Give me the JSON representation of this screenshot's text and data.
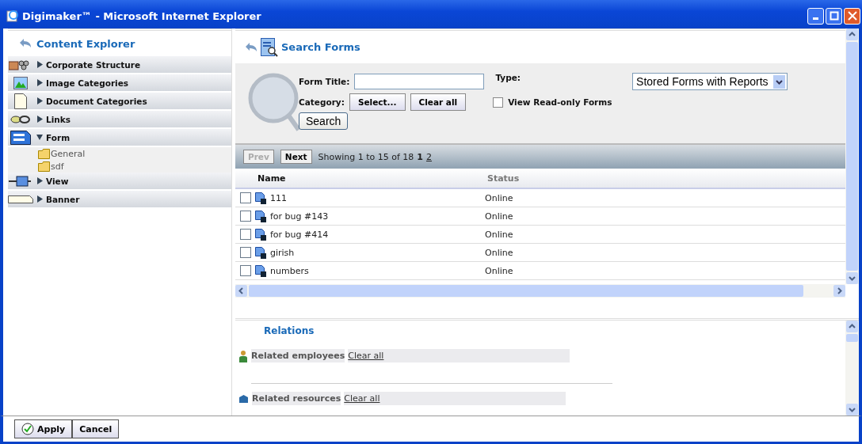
{
  "window": {
    "title": "Digimaker™ - Microsoft Internet Explorer"
  },
  "sidebar": {
    "title": "Content Explorer",
    "items": [
      {
        "label": "Corporate Structure",
        "expanded": false
      },
      {
        "label": "Image Categories",
        "expanded": false
      },
      {
        "label": "Document Categories",
        "expanded": false
      },
      {
        "label": "Links",
        "expanded": false
      },
      {
        "label": "Form",
        "expanded": true,
        "children": [
          {
            "label": "General"
          },
          {
            "label": "sdf"
          }
        ]
      },
      {
        "label": "View",
        "expanded": false
      },
      {
        "label": "Banner",
        "expanded": false
      }
    ]
  },
  "search_panel": {
    "title": "Search Forms",
    "form_title_label": "Form Title:",
    "category_label": "Category:",
    "select_button": "Select...",
    "clear_button": "Clear all",
    "type_label": "Type:",
    "type_value": "Stored Forms with Reports",
    "readonly_label": "View Read-only Forms",
    "readonly_checked": false,
    "search_button": "Search"
  },
  "pager": {
    "prev": "Prev",
    "prev_disabled": true,
    "next": "Next",
    "summary": "Showing 1 to 15 of 18",
    "pages": [
      {
        "label": "1",
        "selected": true
      },
      {
        "label": "2",
        "selected": false
      }
    ]
  },
  "table": {
    "columns": [
      "Name",
      "Status"
    ],
    "rows": [
      {
        "name": "111",
        "status": "Online",
        "checked": false
      },
      {
        "name": "for bug #143",
        "status": "Online",
        "checked": false
      },
      {
        "name": "for bug #414",
        "status": "Online",
        "checked": false
      },
      {
        "name": "girish",
        "status": "Online",
        "checked": false
      },
      {
        "name": "numbers",
        "status": "Online",
        "checked": false
      }
    ]
  },
  "relations": {
    "title": "Relations",
    "groups": [
      {
        "label": "Related employees",
        "clear": "Clear all",
        "kind": "employees"
      },
      {
        "label": "Related resources",
        "clear": "Clear all",
        "kind": "resources"
      }
    ]
  },
  "buttons": [
    {
      "label": "Apply",
      "kind": "apply"
    },
    {
      "label": "Cancel",
      "kind": "cancel"
    }
  ]
}
